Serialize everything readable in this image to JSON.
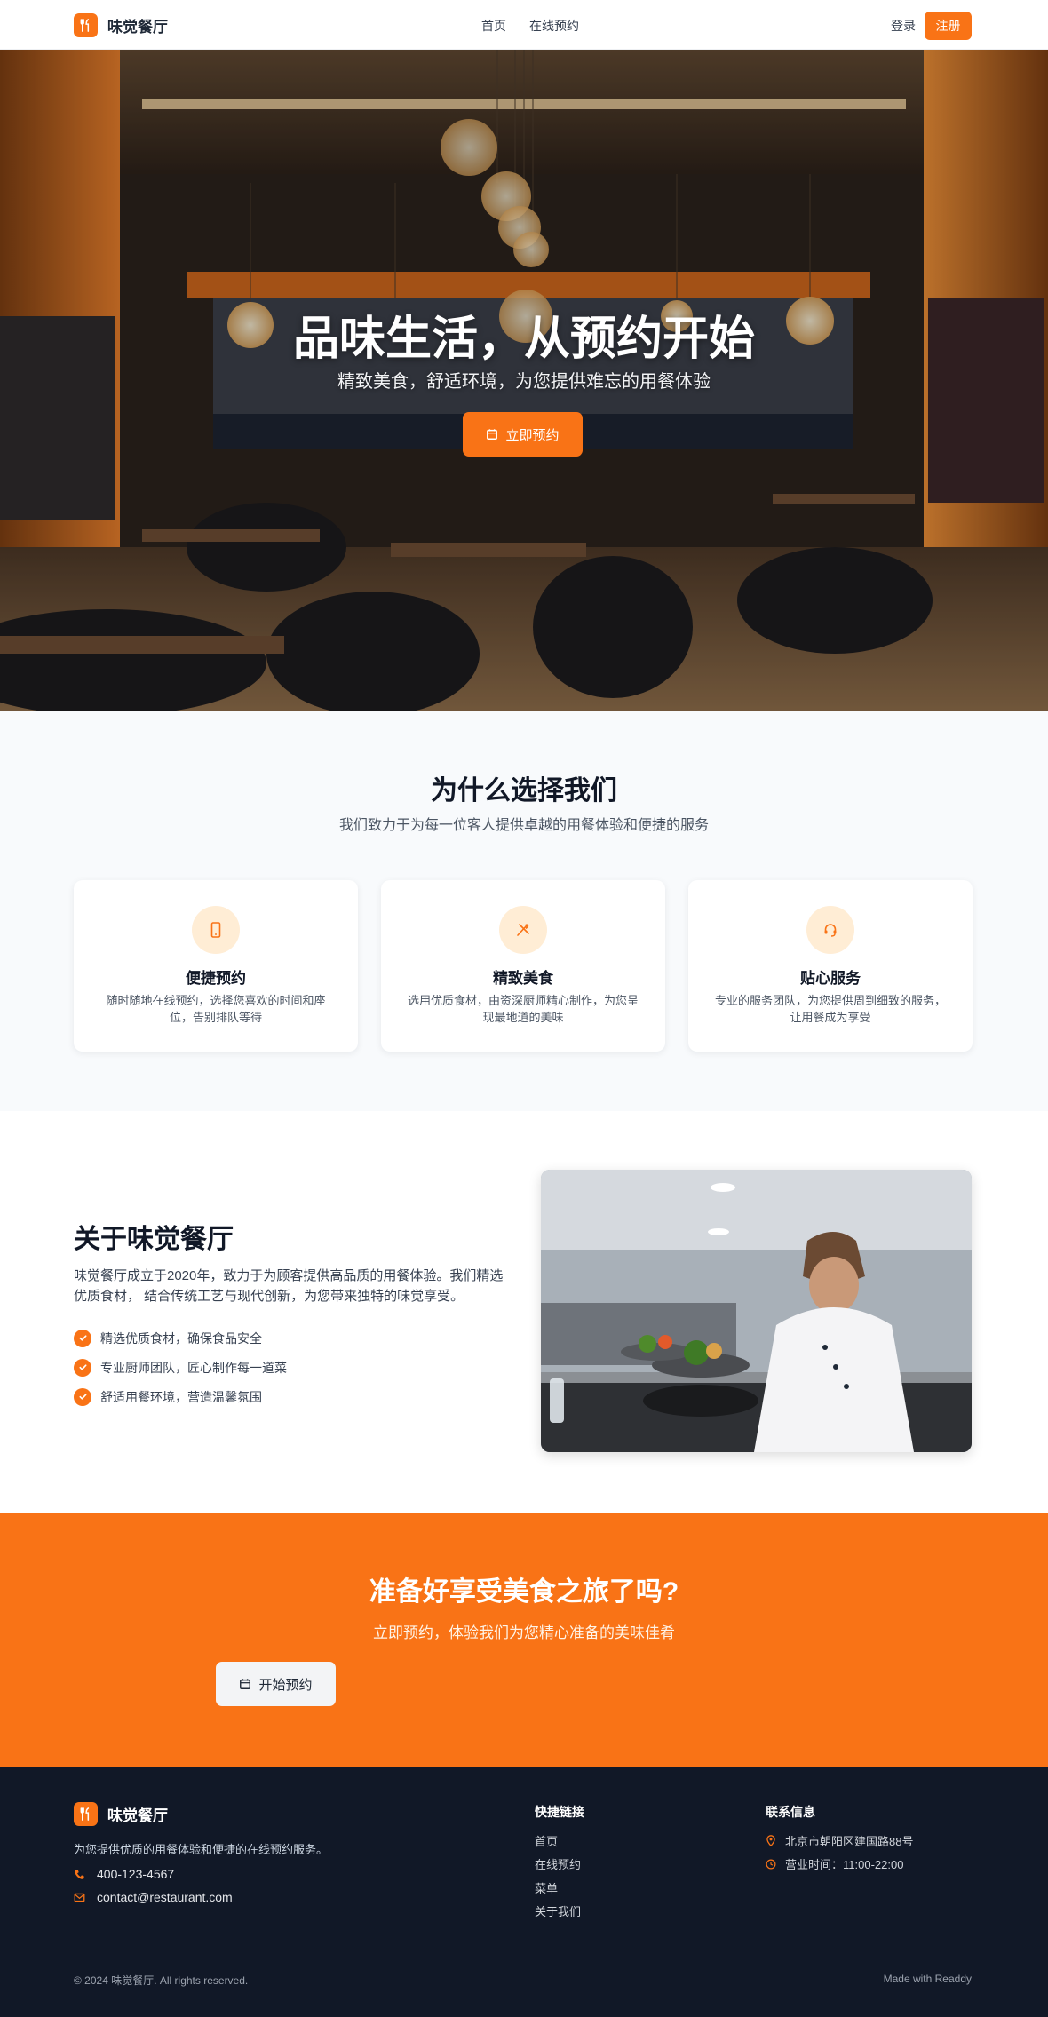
{
  "brand": {
    "name": "味觉餐厅"
  },
  "nav": {
    "links": [
      "首页",
      "在线预约"
    ],
    "login": "登录",
    "register": "注册"
  },
  "hero": {
    "title": "品味生活，从预约开始",
    "subtitle": "精致美食，舒适环境，为您提供难忘的用餐体验",
    "button": "立即预约"
  },
  "why": {
    "title": "为什么选择我们",
    "subtitle": "我们致力于为每一位客人提供卓越的用餐体验和便捷的服务",
    "cards": [
      {
        "icon": "smartphone-icon",
        "title": "便捷预约",
        "desc": "随时随地在线预约，选择您喜欢的时间和座位，告别排队等待"
      },
      {
        "icon": "utensils-icon",
        "title": "精致美食",
        "desc": "选用优质食材，由资深厨师精心制作，为您呈现最地道的美味"
      },
      {
        "icon": "headset-icon",
        "title": "贴心服务",
        "desc": "专业的服务团队，为您提供周到细致的服务，让用餐成为享受"
      }
    ]
  },
  "about": {
    "title": "关于味觉餐厅",
    "desc": "味觉餐厅成立于2020年，致力于为顾客提供高品质的用餐体验。我们精选优质食材， 结合传统工艺与现代创新，为您带来独特的味觉享受。",
    "items": [
      "精选优质食材，确保食品安全",
      "专业厨师团队，匠心制作每一道菜",
      "舒适用餐环境，营造温馨氛围"
    ]
  },
  "cta": {
    "title": "准备好享受美食之旅了吗?",
    "subtitle": "立即预约，体验我们为您精心准备的美味佳肴",
    "button": "开始预约"
  },
  "footer": {
    "brand": "味觉餐厅",
    "desc": "为您提供优质的用餐体验和便捷的在线预约服务。",
    "phone": "400-123-4567",
    "email": "contact@restaurant.com",
    "quick_links_title": "快捷链接",
    "quick_links": [
      "首页",
      "在线预约",
      "菜单",
      "关于我们"
    ],
    "contact_title": "联系信息",
    "address": "北京市朝阳区建国路88号",
    "hours": "营业时间：11:00-22:00",
    "copyright": "© 2024 味觉餐厅. All rights reserved.",
    "made_with": "Made with Readdy"
  },
  "colors": {
    "accent": "#f97316",
    "footer_bg": "#111827",
    "section_bg": "#f8fafc"
  }
}
